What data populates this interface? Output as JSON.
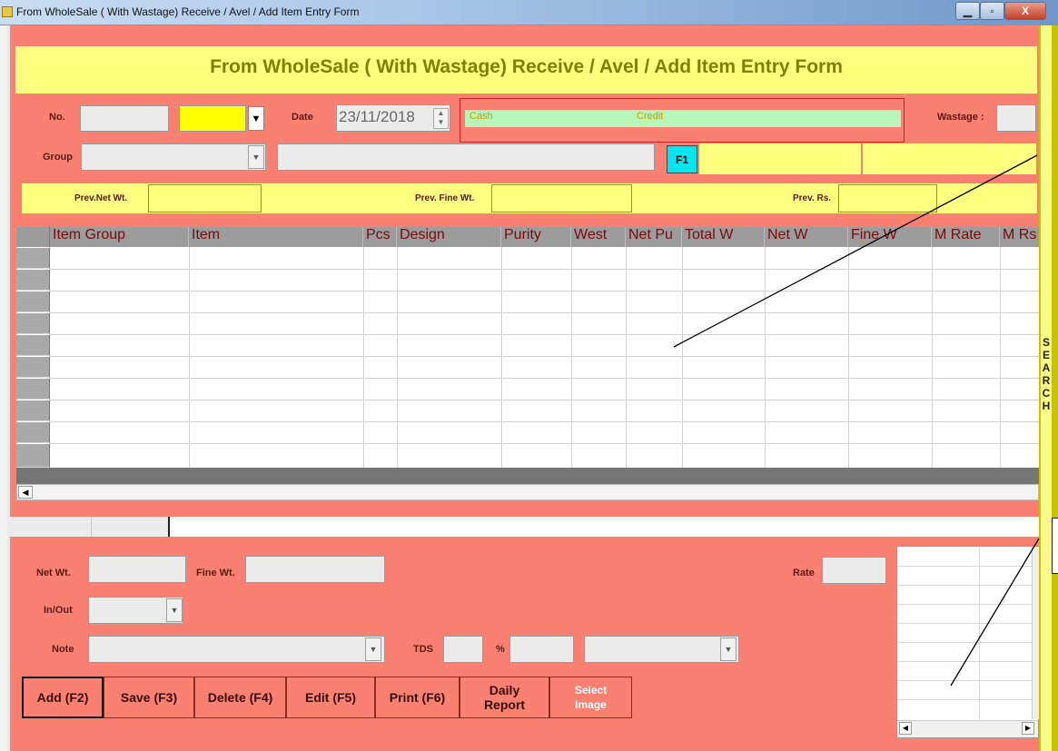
{
  "window": {
    "title": "From WholeSale ( With Wastage) Receive / Avel / Add Item  Entry Form",
    "min_glyph": "▁",
    "max_glyph": "▫",
    "close_glyph": "X"
  },
  "form": {
    "heading": "From WholeSale ( With Wastage) Receive / Avel / Add Item  Entry Form",
    "no_label": "No.",
    "no_value": "",
    "type_value": "",
    "date_label": "Date",
    "date_value": "23/11/2018",
    "cash_label": "Cash",
    "credit_label": "Credit",
    "wastage_label": "Wastage :",
    "wastage_value": "",
    "group_label": "Group",
    "group_value": "",
    "group_desc_value": "",
    "f1_label": "F1",
    "prev_net_label": "Prev.Net Wt.",
    "prev_fine_label": "Prev. Fine Wt.",
    "prev_rs_label": "Prev. Rs."
  },
  "grid": {
    "columns": [
      "Item Group",
      "Item",
      "Pcs",
      "Design",
      "Purity",
      "West",
      "Net Pu",
      "Total W",
      "Net W",
      "Fine W",
      "M Rate",
      "M Rs"
    ],
    "row_count": 10
  },
  "bottom": {
    "net_wt_label": "Net Wt.",
    "fine_wt_label": "Fine Wt.",
    "rate_label": "Rate",
    "inout_label": "In/Out",
    "note_label": "Note",
    "tds_label": "TDS",
    "percent_label": "%"
  },
  "buttons": {
    "add": "Add (F2)",
    "save": "Save (F3)",
    "delete": "Delete (F4)",
    "edit": "Edit (F5)",
    "print": "Print (F6)",
    "daily_report": "Daily Report",
    "select_image": "Select Image"
  },
  "search_strip": "S\nE\nA\nR\nC\nH",
  "colors": {
    "form_bg": "#fa8072",
    "header_band": "#ffff80",
    "title_text": "#808000",
    "payment_green": "#b8f5b8",
    "f1_button": "#00e5ee"
  }
}
